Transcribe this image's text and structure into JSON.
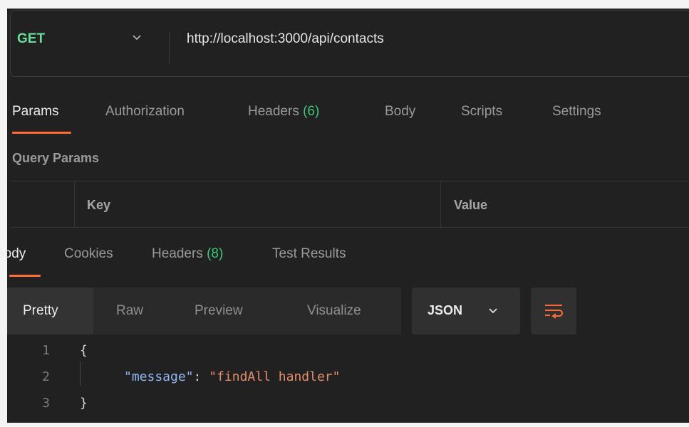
{
  "request": {
    "method": "GET",
    "url": "http://localhost:3000/api/contacts"
  },
  "request_tabs": [
    {
      "label": "Params",
      "active": true
    },
    {
      "label": "Authorization"
    },
    {
      "label": "Headers ",
      "count": "(6)"
    },
    {
      "label": "Body"
    },
    {
      "label": "Scripts"
    },
    {
      "label": "Settings"
    }
  ],
  "query_params": {
    "title": "Query Params",
    "columns": [
      "Key",
      "Value"
    ]
  },
  "response_tabs": [
    {
      "label": "Body",
      "active": true
    },
    {
      "label": "Cookies"
    },
    {
      "label": "Headers ",
      "count": "(8)"
    },
    {
      "label": "Test Results"
    }
  ],
  "format_options": [
    "Pretty",
    "Raw",
    "Preview",
    "Visualize"
  ],
  "format_active": "Pretty",
  "language": "JSON",
  "icons": {
    "method_dropdown": "chevron-down-icon",
    "language_dropdown": "chevron-down-icon",
    "wrap": "wrap-lines-icon"
  },
  "colors": {
    "method": "#6bdd9a",
    "accent": "#ff6c37",
    "count": "#3ec77a",
    "json_key": "#8fb6f2",
    "json_string": "#e58d6a"
  },
  "response_body": {
    "lines": [
      {
        "num": "1",
        "open": "{"
      },
      {
        "num": "2",
        "key": "\"message\"",
        "sep": ": ",
        "value": "\"findAll handler\""
      },
      {
        "num": "3",
        "close": "}"
      }
    ]
  }
}
